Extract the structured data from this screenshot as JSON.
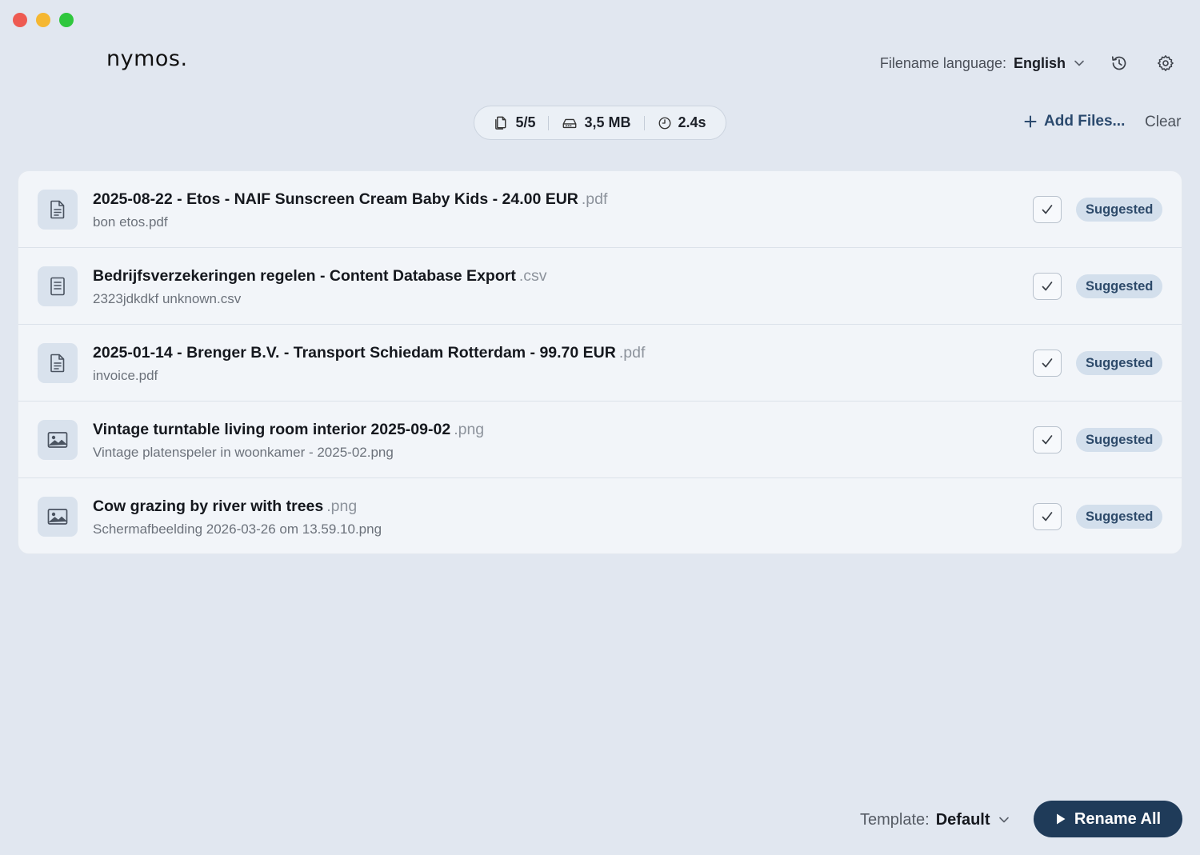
{
  "window": {
    "controls": [
      "close",
      "minimize",
      "zoom"
    ]
  },
  "app": {
    "logo": "nymos."
  },
  "header": {
    "language_label": "Filename language:",
    "language_value": "English",
    "history_icon": "history-icon",
    "settings_icon": "gear-icon"
  },
  "stats": {
    "files": "5/5",
    "size": "3,5 MB",
    "time": "2.4s"
  },
  "actions": {
    "add_files": "Add Files...",
    "clear": "Clear"
  },
  "files": [
    {
      "title": "2025-08-22 - Etos - NAIF Sunscreen Cream Baby Kids - 24.00 EUR",
      "ext": ".pdf",
      "original": "bon etos.pdf",
      "icon": "document-icon",
      "checked": true,
      "status": "Suggested"
    },
    {
      "title": "Bedrijfsverzekeringen regelen - Content Database Export",
      "ext": ".csv",
      "original": "2323jdkdkf unknown.csv",
      "icon": "spreadsheet-icon",
      "checked": true,
      "status": "Suggested"
    },
    {
      "title": "2025-01-14 - Brenger B.V. - Transport Schiedam Rotterdam - 99.70 EUR",
      "ext": ".pdf",
      "original": "invoice.pdf",
      "icon": "document-icon",
      "checked": true,
      "status": "Suggested"
    },
    {
      "title": "Vintage turntable living room interior 2025-09-02",
      "ext": ".png",
      "original": "Vintage platenspeler in woonkamer - 2025-02.png",
      "icon": "image-icon",
      "checked": true,
      "status": "Suggested"
    },
    {
      "title": "Cow grazing by river with trees",
      "ext": ".png",
      "original": "Schermafbeelding 2026-03-26 om 13.59.10.png",
      "icon": "image-icon",
      "checked": true,
      "status": "Suggested"
    }
  ],
  "footer": {
    "template_label": "Template:",
    "template_value": "Default",
    "rename_all": "Rename All"
  },
  "colors": {
    "background": "#e1e7f0",
    "accent": "#1f3b59",
    "badge": "#d3dfec",
    "add_files": "#2b4a6e"
  }
}
